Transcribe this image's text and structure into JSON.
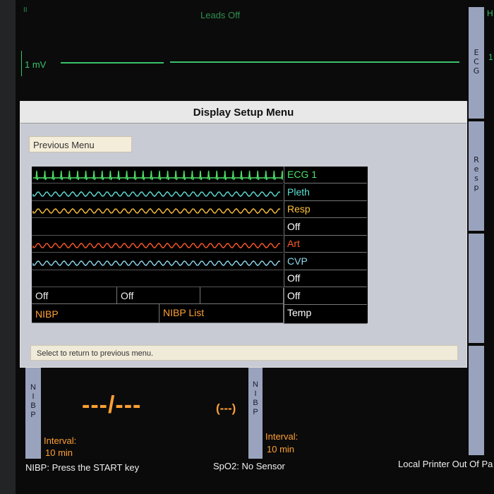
{
  "ecg": {
    "lead": "II",
    "alarm": "Leads Off",
    "scale": "1 mV",
    "right_label": "H",
    "right_value": "1"
  },
  "sidebar": {
    "ecg_tab": "ECG",
    "resp_tab": "Resp"
  },
  "dialog": {
    "title": "Display Setup Menu",
    "previous_menu": "Previous Menu",
    "hint": "Select to return to previous menu.",
    "channels": [
      {
        "label": "ECG 1",
        "color": "#4ee068"
      },
      {
        "label": "Pleth",
        "color": "#5fe0d6"
      },
      {
        "label": "Resp",
        "color": "#ffc23a"
      },
      {
        "label": "Off",
        "color": "#ffffff"
      },
      {
        "label": "Art",
        "color": "#ff5a2a"
      },
      {
        "label": "CVP",
        "color": "#8fd9ef"
      },
      {
        "label": "Off",
        "color": "#ffffff"
      },
      {
        "label": "Off",
        "color": "#ffffff"
      },
      {
        "label": "Temp",
        "color": "#ffffff"
      }
    ],
    "row8": [
      "Off",
      "Off",
      ""
    ],
    "row9": [
      "NIBP",
      "NIBP List"
    ]
  },
  "nibp_left": {
    "tab": "NIBP",
    "value": "---/---",
    "mean": "(---)",
    "interval_label": "Interval:",
    "interval_value": "10 min"
  },
  "nibp_right": {
    "tab": "NIBP",
    "interval_label": "Interval:",
    "interval_value": "10 min"
  },
  "status": {
    "left": "NIBP: Press the START key",
    "center": "SpO2: No Sensor",
    "right": "Local Printer Out Of Pa"
  }
}
